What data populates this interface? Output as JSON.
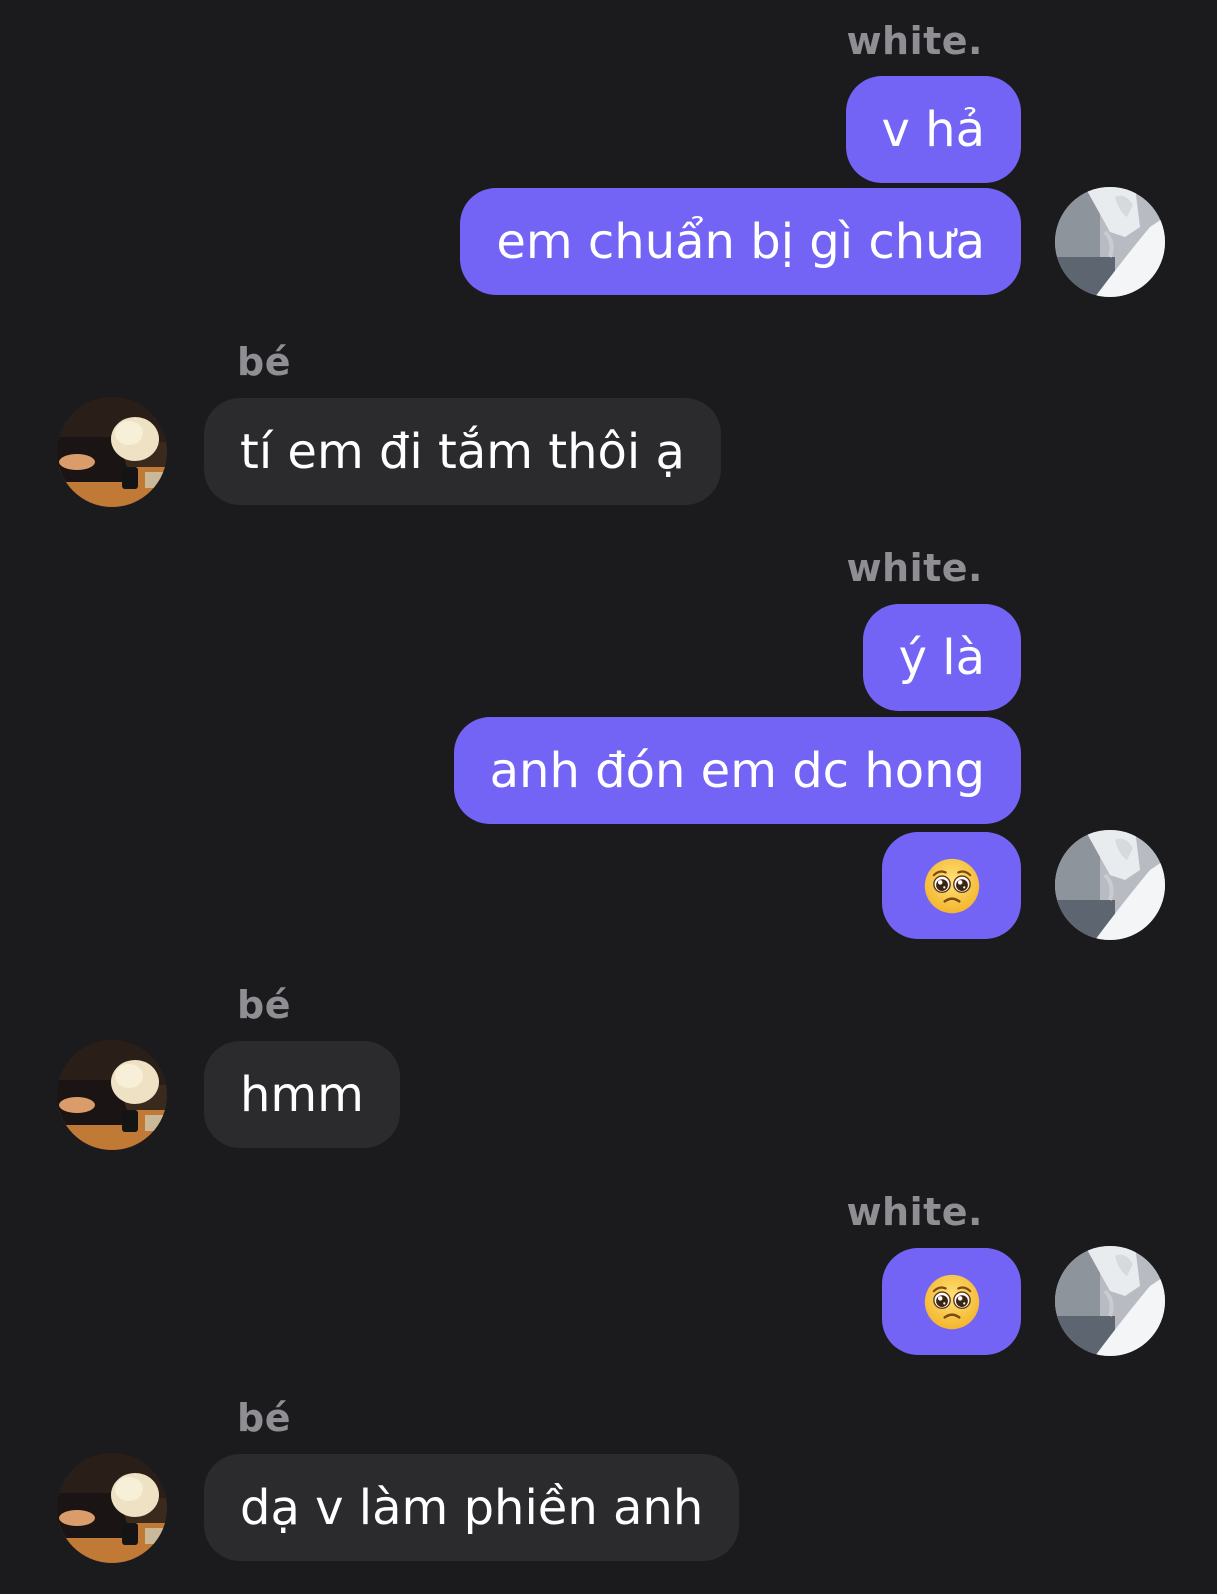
{
  "conversation": {
    "groups": [
      {
        "sender": "white.",
        "direction": "outgoing",
        "messages": [
          "v hả",
          "em chuẩn bị gì chưa"
        ]
      },
      {
        "sender": "bé",
        "direction": "incoming",
        "messages": [
          "tí em đi tắm thôi ạ"
        ]
      },
      {
        "sender": "white.",
        "direction": "outgoing",
        "messages": [
          "ý là",
          "anh đón em dc hong",
          "pleading-face-emoji"
        ]
      },
      {
        "sender": "bé",
        "direction": "incoming",
        "messages": [
          "hmm"
        ]
      },
      {
        "sender": "white.",
        "direction": "outgoing",
        "messages": [
          "pleading-face-emoji"
        ]
      },
      {
        "sender": "bé",
        "direction": "incoming",
        "messages": [
          "dạ v làm phiền anh"
        ]
      }
    ]
  },
  "colors": {
    "background": "#1b1b1e",
    "outgoing_bubble": "#7464f6",
    "incoming_bubble": "#2b2b2e",
    "sender_name": "#8e8e93",
    "message_text": "#ffffff"
  }
}
